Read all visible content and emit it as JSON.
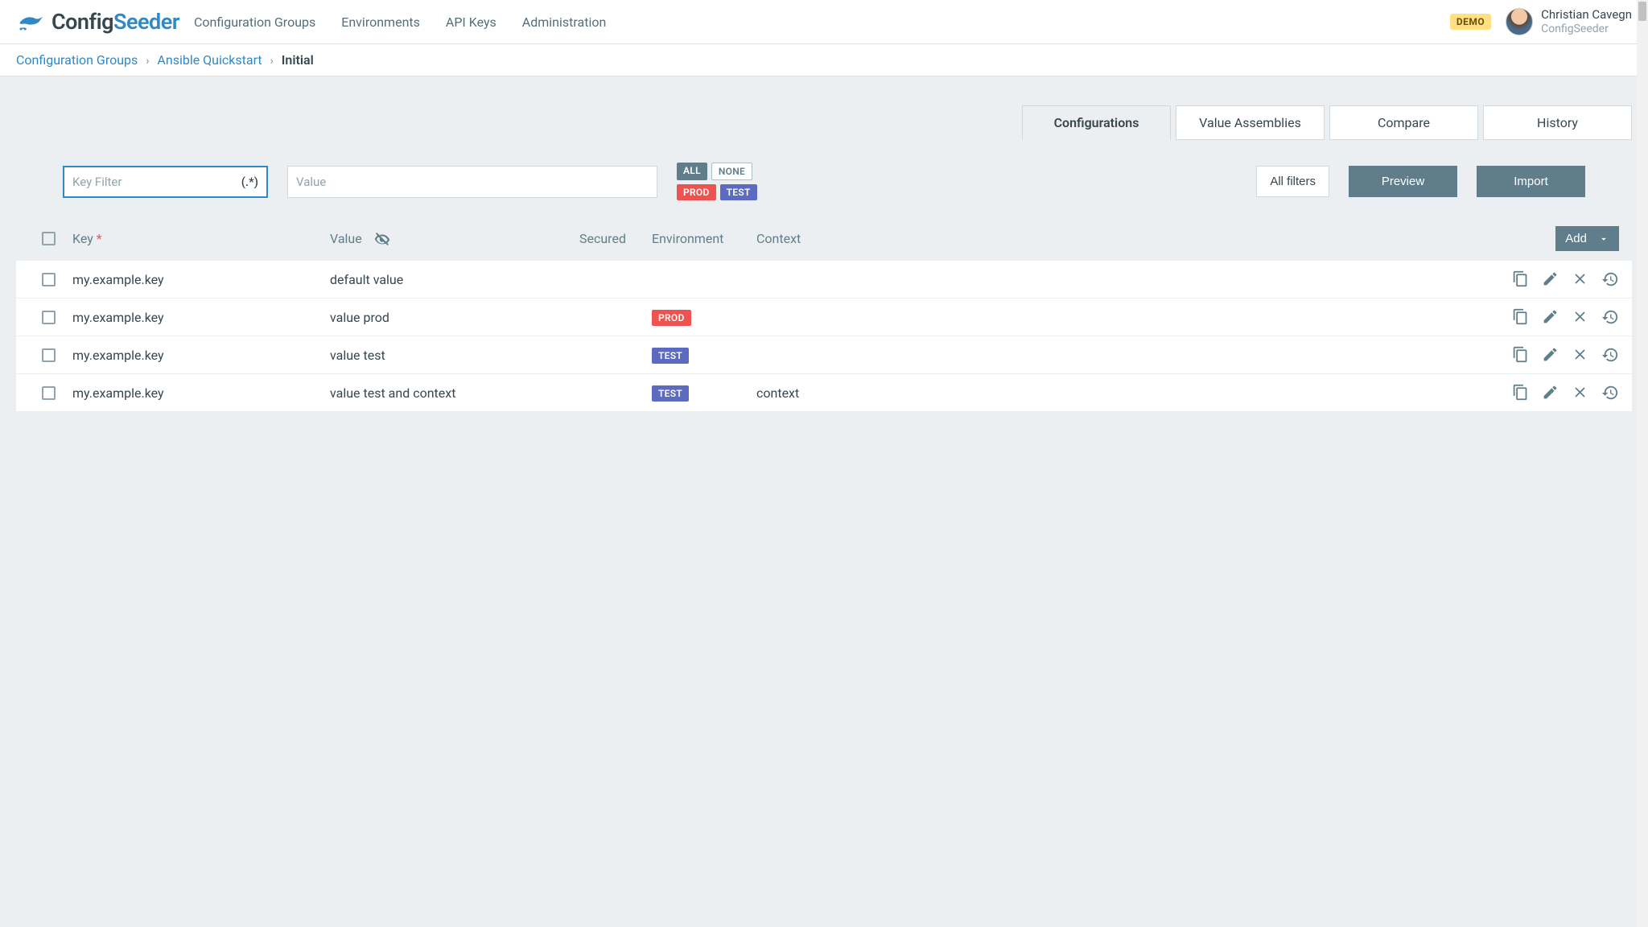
{
  "brand": {
    "part1": "Config",
    "part2": "Seeder"
  },
  "nav": [
    "Configuration Groups",
    "Environments",
    "API Keys",
    "Administration"
  ],
  "demo_badge": "DEMO",
  "user": {
    "name": "Christian Cavegn",
    "org": "ConfigSeeder"
  },
  "breadcrumb": {
    "root": "Configuration Groups",
    "group": "Ansible Quickstart",
    "current": "Initial"
  },
  "tabs": [
    "Configurations",
    "Value Assemblies",
    "Compare",
    "History"
  ],
  "active_tab": 0,
  "filters": {
    "key_placeholder": "Key Filter",
    "regex_hint": "(.*)",
    "value_placeholder": "Value",
    "env_chips": [
      {
        "label": "ALL",
        "cls": "all"
      },
      {
        "label": "NONE",
        "cls": "none"
      },
      {
        "label": "PROD",
        "cls": "prod"
      },
      {
        "label": "TEST",
        "cls": "test"
      }
    ],
    "all_filters": "All filters",
    "preview": "Preview",
    "import": "Import"
  },
  "columns": {
    "key": "Key",
    "value": "Value",
    "secured": "Secured",
    "environment": "Environment",
    "context": "Context",
    "add": "Add"
  },
  "rows": [
    {
      "key": "my.example.key",
      "value": "default value",
      "env": null,
      "context": ""
    },
    {
      "key": "my.example.key",
      "value": "value prod",
      "env": "PROD",
      "context": ""
    },
    {
      "key": "my.example.key",
      "value": "value test",
      "env": "TEST",
      "context": ""
    },
    {
      "key": "my.example.key",
      "value": "value test and context",
      "env": "TEST",
      "context": "context"
    }
  ]
}
